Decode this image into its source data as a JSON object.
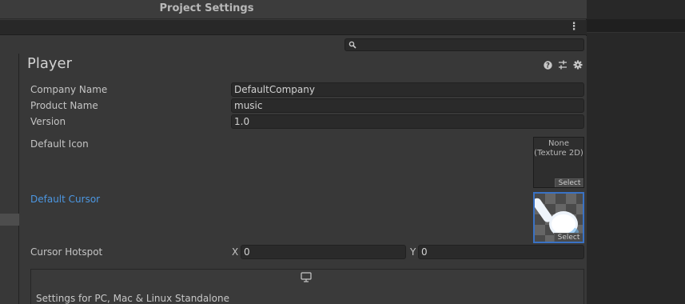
{
  "window": {
    "title": "Project Settings"
  },
  "search": {
    "placeholder": "",
    "value": ""
  },
  "header": {
    "title": "Player"
  },
  "fields": {
    "company_name": {
      "label": "Company Name",
      "value": "DefaultCompany"
    },
    "product_name": {
      "label": "Product Name",
      "value": "music"
    },
    "version": {
      "label": "Version",
      "value": "1.0"
    }
  },
  "default_icon": {
    "label": "Default Icon",
    "slot_text_line1": "None",
    "slot_text_line2": "(Texture 2D)",
    "select_label": "Select"
  },
  "default_cursor": {
    "label": "Default Cursor",
    "select_label": "Select"
  },
  "cursor_hotspot": {
    "label": "Cursor Hotspot",
    "x_label": "X",
    "x_value": "0",
    "y_label": "Y",
    "y_value": "0"
  },
  "platform": {
    "label": "Settings for PC, Mac & Linux Standalone",
    "icon": "monitor-icon"
  },
  "icons": {
    "search": "search-icon",
    "help": "help-icon",
    "presets": "sliders-icon",
    "settings": "gear-icon",
    "menu": "kebab-menu-icon"
  },
  "colors": {
    "link": "#4c97e2",
    "selection_border": "#3a72c4",
    "panel": "#383838"
  }
}
